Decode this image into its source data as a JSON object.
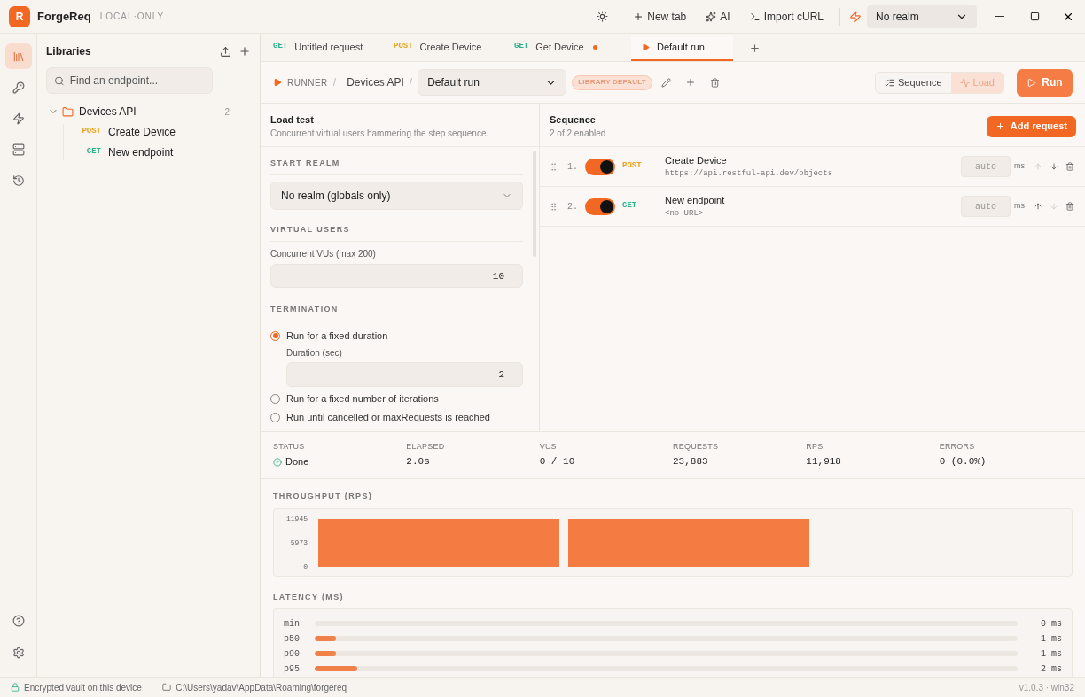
{
  "app": {
    "logo": "R",
    "name": "ForgeReq",
    "badge": "LOCAL·ONLY"
  },
  "titlebar": {
    "actions": [
      {
        "kind": "theme"
      },
      {
        "kind": "new",
        "label": "New tab"
      },
      {
        "kind": "ai",
        "label": "AI"
      },
      {
        "kind": "curl",
        "label": "Import cURL"
      }
    ],
    "realm": "No realm"
  },
  "rail": [
    {
      "kind": "library",
      "selected": true
    },
    {
      "kind": "key",
      "selected": false
    },
    {
      "kind": "bolt",
      "selected": false
    },
    {
      "kind": "server",
      "selected": false
    },
    {
      "kind": "history",
      "selected": false
    }
  ],
  "sidebar": {
    "title": "Libraries",
    "search": {
      "placeholder": "Find an endpoint..."
    },
    "tree": [
      {
        "label": "Devices API",
        "count": "2",
        "expanded": true,
        "children": [
          {
            "method": "POST",
            "label": "Create Device"
          },
          {
            "method": "GET",
            "label": "New endpoint"
          }
        ]
      }
    ]
  },
  "tabs": [
    {
      "kind": "request",
      "method": "GET",
      "label": "Untitled request",
      "dirty": false,
      "selected": false
    },
    {
      "kind": "request",
      "method": "POST",
      "label": "Create Device",
      "dirty": false,
      "selected": false
    },
    {
      "kind": "request",
      "method": "GET",
      "label": "Get Device",
      "dirty": true,
      "selected": false
    },
    {
      "kind": "runner",
      "label": "Default run",
      "dirty": false,
      "selected": true
    }
  ],
  "toolbar": {
    "breadcrumb": [
      "RUNNER",
      "Devices API"
    ],
    "separator": "/",
    "run_select": "Default run",
    "tag": "LIBRARY DEFAULT",
    "modes": [
      {
        "label": "Sequence",
        "selected": false
      },
      {
        "label": "Load",
        "selected": true
      }
    ],
    "run": "Run"
  },
  "load_test": {
    "title": "Load test",
    "subtitle": "Concurrent virtual users hammering the step sequence.",
    "start_realm": {
      "heading": "START REALM",
      "value": "No realm (globals only)"
    },
    "virtual_users": {
      "heading": "VIRTUAL USERS",
      "label": "Concurrent VUs (max 200)",
      "value": "10"
    },
    "termination": {
      "heading": "TERMINATION",
      "options": [
        {
          "label": "Run for a fixed duration",
          "selected": true,
          "field": {
            "label": "Duration (sec)",
            "value": "2"
          }
        },
        {
          "label": "Run for a fixed number of iterations",
          "selected": false
        },
        {
          "label": "Run until cancelled or maxRequests is reached",
          "selected": false
        }
      ]
    }
  },
  "sequence": {
    "title": "Sequence",
    "subtitle": "2 of 2 enabled",
    "add": "Add request",
    "steps": [
      {
        "index": "1.",
        "on": true,
        "method": "POST",
        "name": "Create Device",
        "url": "https://api.restful-api.dev/objects",
        "delay_placeholder": "auto",
        "unit": "ms",
        "can_up": false,
        "can_down": true
      },
      {
        "index": "2.",
        "on": true,
        "method": "GET",
        "name": "New endpoint",
        "url": "<no URL>",
        "delay_placeholder": "auto",
        "unit": "ms",
        "can_up": true,
        "can_down": false
      }
    ]
  },
  "stats": [
    {
      "label": "STATUS",
      "value": "Done",
      "kind": "status"
    },
    {
      "label": "ELAPSED",
      "value": "2.0s"
    },
    {
      "label": "VUS",
      "value": "0 / 10"
    },
    {
      "label": "REQUESTS",
      "value": "23,883"
    },
    {
      "label": "RPS",
      "value": "11,918"
    },
    {
      "label": "ERRORS",
      "value": "0 (0.0%)"
    }
  ],
  "throughput": {
    "heading": "THROUGHPUT (RPS)",
    "chart_data": {
      "type": "bar",
      "ylim": [
        0,
        11945
      ],
      "yticks": [
        0,
        5973,
        11945
      ],
      "categories": [
        null,
        null
      ],
      "series": [
        {
          "color": "#f47c42",
          "values": [
            11945,
            11945
          ]
        }
      ]
    }
  },
  "latency": {
    "heading": "LATENCY (MS)",
    "rows": [
      {
        "label": "min",
        "level": 0,
        "value": "0 ms"
      },
      {
        "label": "p50",
        "level": 0.03,
        "value": "1 ms"
      },
      {
        "label": "p90",
        "level": 0.03,
        "value": "1 ms"
      },
      {
        "label": "p95",
        "level": 0.06,
        "value": "2 ms"
      }
    ]
  },
  "status_bar": {
    "vault": "Encrypted vault on this device",
    "separator": "·",
    "path": "C:\\Users\\yadav\\AppData\\Roaming\\forgereq",
    "version": "v1.0.3 · win32"
  }
}
